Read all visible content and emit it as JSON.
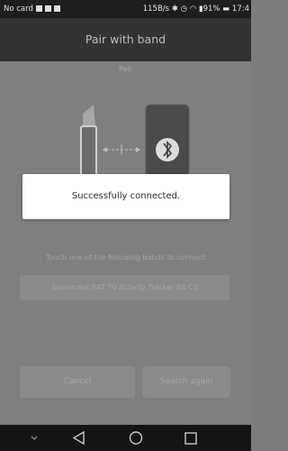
{
  "status_bar": {
    "carrier": "No card",
    "speed": "115B/s",
    "battery": "91%",
    "time": "17:4"
  },
  "header": {
    "title": "Pair with band"
  },
  "main": {
    "subtitle": "Pair",
    "hint": "Touch one of the following bands to connect",
    "devices": [
      "Silvercrest SAT 70 Activity Tracker B4 C3"
    ]
  },
  "dialog": {
    "message": "Successfully connected."
  },
  "actions": {
    "cancel_label": "Cancel",
    "search_label": "Search again"
  },
  "icons": {
    "bluetooth": "bluetooth-icon",
    "back": "back-triangle-icon",
    "home": "home-circle-icon",
    "recent": "recent-square-icon",
    "down": "chevron-down-icon"
  },
  "colors": {
    "dialog_bg": "#ffffff",
    "header_bg": "#333333",
    "overlay": "#7f7f7f"
  }
}
